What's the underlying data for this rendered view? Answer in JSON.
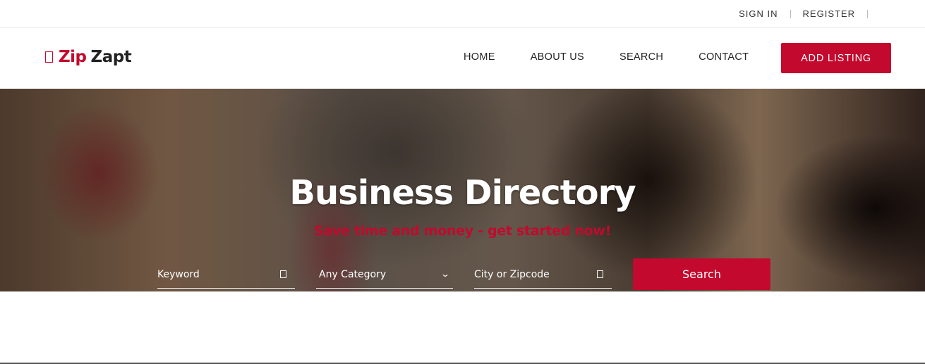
{
  "topbar": {
    "sign_in": "SIGN IN",
    "register": "REGISTER"
  },
  "header": {
    "logo": {
      "icon": "logo-mark-icon",
      "part1": "Zip",
      "part2": "Zapt"
    },
    "nav": [
      {
        "label": "HOME"
      },
      {
        "label": "ABOUT US"
      },
      {
        "label": "SEARCH"
      },
      {
        "label": "CONTACT"
      }
    ],
    "add_listing": "ADD LISTING"
  },
  "hero": {
    "title": "Business Directory",
    "subtitle": "Save time and money - get started now!"
  },
  "search": {
    "keyword_placeholder": "Keyword",
    "category_selected": "Any Category",
    "city_placeholder": "City or Zipcode",
    "button_label": "Search"
  },
  "colors": {
    "accent": "#c3092d",
    "text": "#222222",
    "white": "#ffffff"
  }
}
